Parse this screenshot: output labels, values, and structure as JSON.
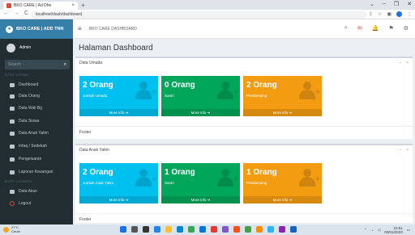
{
  "browser": {
    "tab_title": "BKO CARE | Ad Dhe",
    "tab_close": "×",
    "new_tab": "+",
    "window_controls": [
      "⌄",
      "–",
      "❐",
      "✕"
    ],
    "nav": [
      "←",
      "→",
      "C",
      "⌂"
    ],
    "url": "localhost/dash/dashboard"
  },
  "sidebar": {
    "brand": "BKO CARE | ADD TNN",
    "user_name": "Admin",
    "search_placeholder": "Search",
    "header_main": "DATA UTAMA",
    "items": [
      {
        "label": "Dashboard"
      },
      {
        "label": "Data Orang"
      },
      {
        "label": "Data Wali Bg"
      },
      {
        "label": "Data Siswa"
      },
      {
        "label": "Data Anak Yatim"
      },
      {
        "label": "Infaq / Sedekah"
      },
      {
        "label": "Pengeluaran"
      },
      {
        "label": "Laporan Keuangan"
      }
    ],
    "header_other": "DATA LAINNYA",
    "items2": [
      {
        "label": "Data Akun"
      },
      {
        "label": "Logout"
      }
    ]
  },
  "header": {
    "hamburger": "≡",
    "app_title": "BKO CARE DASHBOARD",
    "icons": [
      "🔍",
      "✉",
      "🔔",
      "⚑",
      "⚙"
    ]
  },
  "page": {
    "title": "Halaman Dashboard"
  },
  "box1": {
    "title": "Data Umada",
    "tools": [
      "–",
      "×"
    ],
    "footer": "Footer",
    "cards": [
      {
        "value": "2 Orang",
        "label": "Jumlah Umada",
        "more": "More info ➜",
        "color": "#00c0ef"
      },
      {
        "value": "0 Orang",
        "label": "Santri",
        "more": "More info ➜",
        "color": "#00a65a"
      },
      {
        "value": "2 Orang",
        "label": "Pendamping",
        "more": "More info ➜",
        "color": "#f39c12"
      }
    ]
  },
  "box2": {
    "title": "Data Anak Yatim",
    "tools": [
      "–",
      "×"
    ],
    "footer": "Footer",
    "cards": [
      {
        "value": "2 Orang",
        "label": "Jumlah Anak Yatim",
        "more": "More info ➜",
        "color": "#00c0ef"
      },
      {
        "value": "1 Orang",
        "label": "Santri",
        "more": "More info ➜",
        "color": "#00a65a"
      },
      {
        "value": "1 Orang",
        "label": "Pendamping",
        "more": "More info ➜",
        "color": "#f39c12"
      }
    ]
  },
  "taskbar": {
    "weather_temp": "27°C",
    "weather_desc": "Cerah",
    "time": "15:51",
    "date": "03/01/2023"
  }
}
